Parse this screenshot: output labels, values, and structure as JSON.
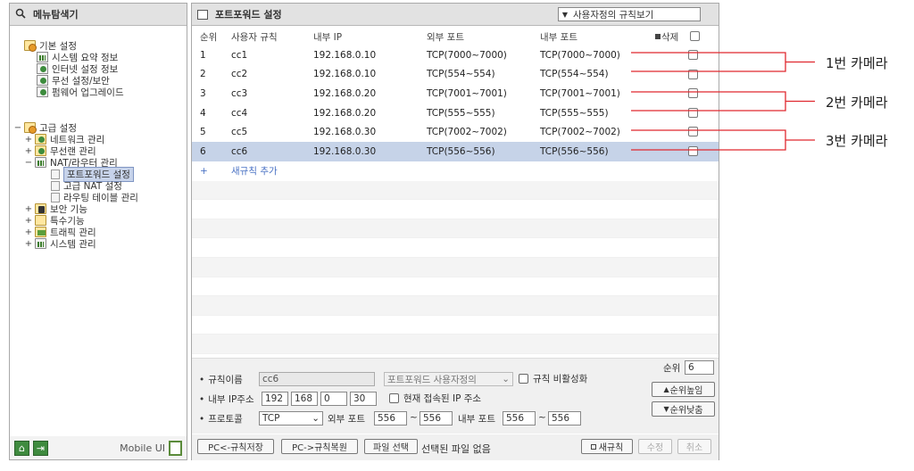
{
  "sidebar": {
    "title": "메뉴탐색기",
    "tree": {
      "basic": {
        "label": "기본 설정",
        "items": [
          "시스템 요약 정보",
          "인터넷 설정 정보",
          "무선 설정/보안",
          "펌웨어 업그레이드"
        ]
      },
      "advanced": {
        "label": "고급 설정",
        "network": "네트워크 관리",
        "wireless": "무선랜 관리",
        "nat": "NAT/라우터 관리",
        "nat_items": [
          "포트포워드 설정",
          "고급 NAT 설정",
          "라우팅 테이블 관리"
        ],
        "security": "보안 기능",
        "special": "특수기능",
        "traffic": "트래픽 관리",
        "system": "시스템 관리"
      }
    },
    "mobile_ui": "Mobile UI"
  },
  "main": {
    "title": "포트포워드 설정",
    "view_select": "사용자정의 규칙보기",
    "columns": {
      "order": "순위",
      "name": "사용자 규칙",
      "internal_ip": "내부 IP",
      "external_port": "외부 포트",
      "internal_port": "내부 포트",
      "delete": "삭제"
    },
    "rules": [
      {
        "order": "1",
        "name": "cc1",
        "ip": "192.168.0.10",
        "ext": "TCP(7000~7000)",
        "int": "TCP(7000~7000)"
      },
      {
        "order": "2",
        "name": "cc2",
        "ip": "192.168.0.10",
        "ext": "TCP(554~554)",
        "int": "TCP(554~554)"
      },
      {
        "order": "3",
        "name": "cc3",
        "ip": "192.168.0.20",
        "ext": "TCP(7001~7001)",
        "int": "TCP(7001~7001)"
      },
      {
        "order": "4",
        "name": "cc4",
        "ip": "192.168.0.20",
        "ext": "TCP(555~555)",
        "int": "TCP(555~555)"
      },
      {
        "order": "5",
        "name": "cc5",
        "ip": "192.168.0.30",
        "ext": "TCP(7002~7002)",
        "int": "TCP(7002~7002)"
      },
      {
        "order": "6",
        "name": "cc6",
        "ip": "192.168.0.30",
        "ext": "TCP(556~556)",
        "int": "TCP(556~556)"
      }
    ],
    "add_rule": "새규칙 추가",
    "form": {
      "rule_name_label": "규칙이름",
      "rule_name_value": "cc6",
      "rule_type": "포트포워드 사용자정의",
      "disable_label": "규칙 비활성화",
      "ip_label": "내부 IP주소",
      "ip": [
        "192",
        "168",
        "0",
        "30"
      ],
      "current_ip_label": "현재 접속된 IP 주소",
      "protocol_label": "프로토콜",
      "protocol_value": "TCP",
      "ext_port_label": "외부 포트",
      "ext_from": "556",
      "ext_to": "556",
      "int_port_label": "내부 포트",
      "int_from": "556",
      "int_to": "556",
      "tilde": "~",
      "order_label": "순위",
      "order_value": "6",
      "order_up": "순위높임",
      "order_down": "순위낮춤"
    },
    "toolbar": {
      "save_pc": "PC<-규칙저장",
      "restore_pc": "PC->규칙복원",
      "file_select": "파일 선택",
      "no_file": "선택된 파일 없음",
      "new_rule": "새규칙",
      "modify": "수정",
      "cancel": "취소"
    }
  },
  "annotations": [
    {
      "label": "1번 카메라"
    },
    {
      "label": "2번 카메라"
    },
    {
      "label": "3번 카메라"
    }
  ],
  "colors": {
    "annotation_line": "#e0282f",
    "selected_row": "#c6d3e8",
    "link_blue": "#4a72c4"
  }
}
